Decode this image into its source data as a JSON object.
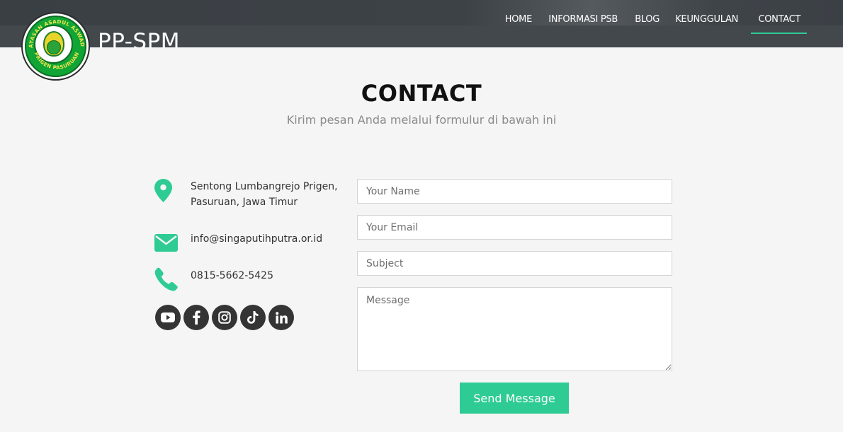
{
  "header": {
    "brand": "PP-SPM",
    "logo_text": "YAYASAN ASADUL ASWADH · PRIGEN PASURUAN",
    "nav": [
      {
        "label": "HOME"
      },
      {
        "label": "INFORMASI PSB"
      },
      {
        "label": "BLOG"
      },
      {
        "label": "KEUNGGULAN"
      },
      {
        "label": "CONTACT",
        "active": true
      }
    ]
  },
  "section": {
    "title": "CONTACT",
    "subtitle": "Kirim pesan Anda melalui formulur di bawah ini"
  },
  "contact": {
    "address_line1": "Sentong Lumbangrejo Prigen,",
    "address_line2": "Pasuruan, Jawa Timur",
    "email": "info@singaputihputra.or.id",
    "phone": "0815-5662-5425",
    "icons": [
      "map-pin-icon",
      "envelope-icon",
      "phone-icon"
    ],
    "social": [
      "youtube-icon",
      "facebook-icon",
      "instagram-icon",
      "tiktok-icon",
      "linkedin-icon"
    ]
  },
  "form": {
    "name_placeholder": "Your Name",
    "email_placeholder": "Your Email",
    "subject_placeholder": "Subject",
    "message_placeholder": "Message",
    "submit_label": "Send Message"
  },
  "colors": {
    "accent": "#2ecc94",
    "header_bg": "#43484d",
    "social_bg": "#343434",
    "page_bg": "#f5f5f5"
  }
}
